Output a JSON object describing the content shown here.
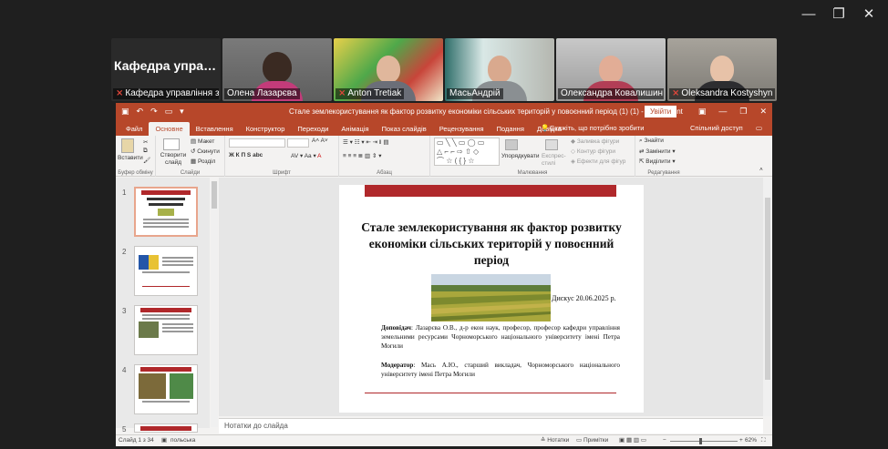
{
  "window_controls": {
    "minimize": "—",
    "restore": "❐",
    "close": "✕"
  },
  "meeting": {
    "participants": [
      {
        "name": "Кафедра управління з...",
        "big_label": "Кафедра управ...",
        "muted": true
      },
      {
        "name": "Олена Лазарєва",
        "muted": false
      },
      {
        "name": "Anton Tretiak",
        "muted": true
      },
      {
        "name": "МасьАндрій",
        "muted": false
      },
      {
        "name": "Олександра Ковалишин",
        "muted": false,
        "active": true
      },
      {
        "name": "Oleksandra Kostyshyn",
        "muted": true
      }
    ]
  },
  "powerpoint": {
    "title": "Стале землекористування як фактор розвитку економіки сільських територій у повоєнний період (1) (1)  -  PowerPoint",
    "signin": "Увійти",
    "tabs": [
      "Файл",
      "Основне",
      "Вставлення",
      "Конструктор",
      "Переходи",
      "Анімація",
      "Показ слайдів",
      "Рецензування",
      "Подання",
      "Довідка"
    ],
    "active_tab": "Основне",
    "tell_me": "Скажіть, що потрібно зробити",
    "share": "Спільний доступ",
    "ribbon": {
      "groups": [
        "Буфер обміну",
        "Слайди",
        "Шрифт",
        "Абзац",
        "Малювання",
        "Редагування"
      ],
      "paste": "Вставити",
      "new_slide": "Створити слайд",
      "layout": "Макет",
      "reset": "Скинути",
      "section": "Розділ",
      "font_styles": "Ж К П S abc",
      "arrange": "Упорядкувати",
      "quick_styles": "Експрес-стилі",
      "shape_fill": "Заливка фігури",
      "shape_outline": "Контур фігури",
      "shape_effects": "Ефекти для фігур",
      "find": "Знайти",
      "replace": "Замінити",
      "select": "Виділити"
    },
    "thumbnails": [
      1,
      2,
      3,
      4,
      5
    ],
    "slide": {
      "title": "Стале землекористування як фактор розвитку економіки сільських територій у повоєнний період",
      "date": "Дискус 20.06.2025 р.",
      "speaker_label": "Доповідач",
      "speaker": ": Лазарєва О.В., д-р екон наук, професор, професор кафедри управління земельними ресурсами Чорноморського національного університету імені Петра Могили",
      "moderator_label": "Модератор",
      "moderator": ": Мась А.Ю., старший викладач, Чорноморського національного університету імені Петра Могили"
    },
    "notes_placeholder": "Нотатки до слайда",
    "status": {
      "slide": "Слайд 1 з 34",
      "language": "польська",
      "notes": "Нотатки",
      "comments": "Примітки",
      "zoom": "62%"
    }
  }
}
